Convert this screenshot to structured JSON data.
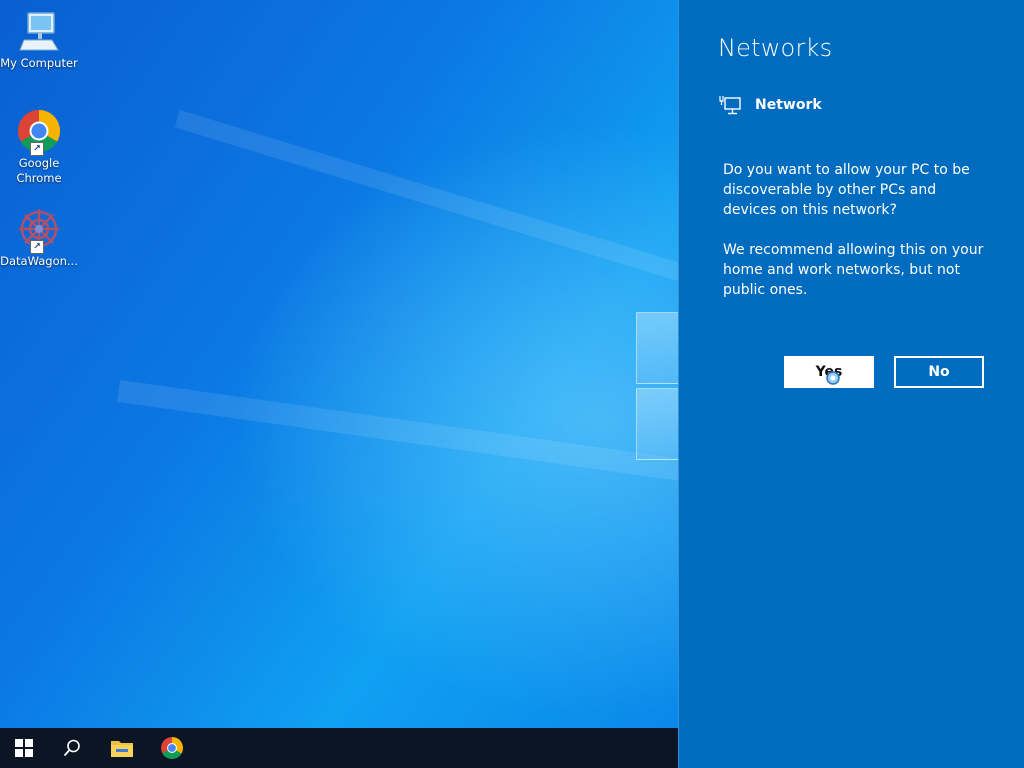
{
  "desktop": {
    "icons": [
      {
        "label": "My Computer",
        "icon": "computer-icon"
      },
      {
        "label": "Google Chrome",
        "icon": "chrome-icon"
      },
      {
        "label": "DataWagon...",
        "icon": "datawagon-icon"
      }
    ]
  },
  "taskbar": {
    "items": [
      "windows-start-icon",
      "search-icon",
      "file-explorer-icon",
      "chrome-icon"
    ]
  },
  "flyout": {
    "title": "Networks",
    "network_name": "Network",
    "question": "Do you want to allow your PC to be discoverable by other PCs and devices on this network?",
    "recommendation": "We recommend allowing this on your home and work networks, but not public ones.",
    "yes_label": "Yes",
    "no_label": "No"
  },
  "colors": {
    "flyout_bg": "#006cbf",
    "taskbar_bg": "#0b1524",
    "wallpaper_accent": "#0b78e3"
  }
}
